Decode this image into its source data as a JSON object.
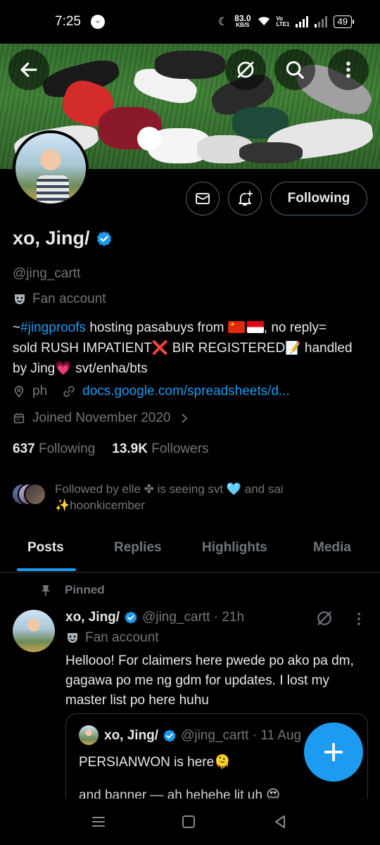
{
  "status_bar": {
    "time": "7:25",
    "net_speed": "83.0",
    "net_unit": "KB/S",
    "volte": "Vo LTE1",
    "battery": "49"
  },
  "profile": {
    "name": "xo, Jing/",
    "handle": "@jing_cartt",
    "category": "Fan account",
    "bio": {
      "prefix": "~",
      "hashtag": "#jingproofs",
      "part1": " hosting pasabuys from ",
      "part2": ", no reply=",
      "part3": "sold RUSH IMPATIENT",
      "part4": " BIR REGISTERED",
      "part5": " handled",
      "part6": "by Jing",
      "part7": " svt/enha/bts"
    },
    "location": "ph",
    "website": "docs.google.com/spreadsheets/d...",
    "joined": "Joined November 2020",
    "following_count": "637",
    "following_label": "Following",
    "followers_count": "13.9K",
    "followers_label": "Followers",
    "followed_by": "Followed by elle ✤ is seeing svt 🩵 and sai ✨hoonkicember"
  },
  "actions": {
    "follow_label": "Following"
  },
  "tabs": [
    {
      "label": "Posts"
    },
    {
      "label": "Replies"
    },
    {
      "label": "Highlights"
    },
    {
      "label": "Media"
    }
  ],
  "pinned_post": {
    "pinned_label": "Pinned",
    "name": "xo, Jing/",
    "handle_time": "@jing_cartt · 21h",
    "category": "Fan account",
    "text": "Hellooo! For claimers here pwede po ako pa dm, gagawa po me ng gdm for updates. I lost my master list po here huhu",
    "quote": {
      "name": "xo, Jing/",
      "handle_time": "@jing_cartt · 11 Aug",
      "text": "PERSIANWON is here🫠",
      "text2": "and banner — ah hehehe lit uh 😍"
    }
  },
  "colors": {
    "accent": "#1d9bf0",
    "muted": "#71767b",
    "border": "#2f3336",
    "background": "#000000"
  },
  "icons": [
    "back-arrow-icon",
    "grok-icon",
    "search-icon",
    "more-vertical-icon",
    "mail-icon",
    "bell-plus-icon",
    "verified-badge-icon",
    "theater-mask-icon",
    "location-icon",
    "link-icon",
    "calendar-icon",
    "chevron-right-icon",
    "pin-icon",
    "plus-icon"
  ]
}
